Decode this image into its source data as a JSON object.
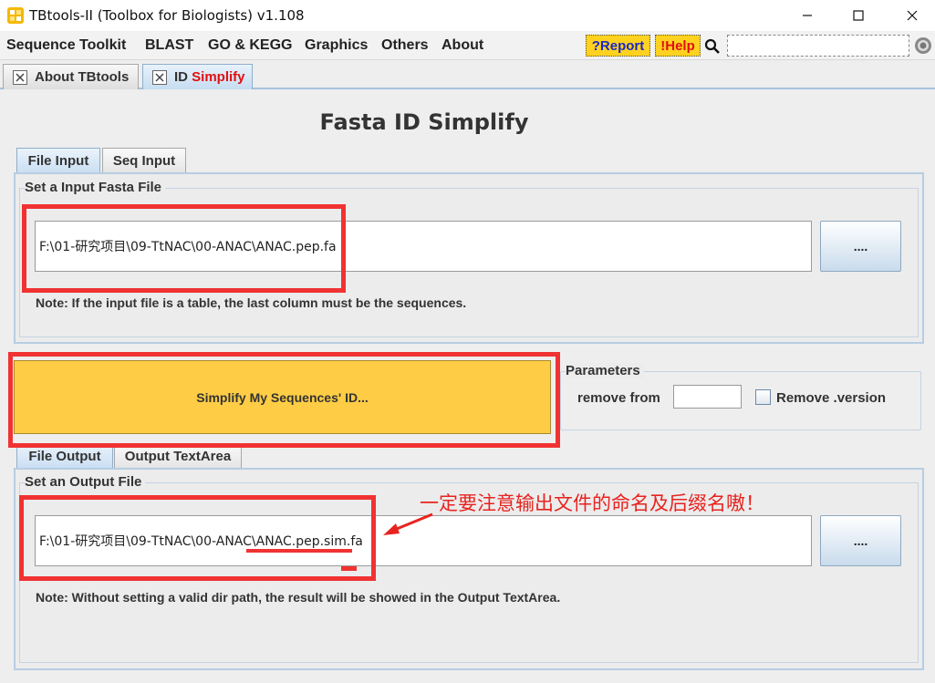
{
  "window": {
    "title": "TBtools-II (Toolbox for Biologists) v1.108",
    "controls": [
      "minimize-icon",
      "maximize-icon",
      "close-icon"
    ]
  },
  "menubar": {
    "items": [
      "Sequence Toolkit",
      "BLAST",
      "GO & KEGG",
      "Graphics",
      "Others",
      "About"
    ],
    "report_label": "?Report",
    "help_label": "!Help",
    "search_value": "",
    "accent_color": "#ffd21f"
  },
  "doc_tabs": {
    "tab1_label": "About TBtools",
    "tab2_prefix": "ID ",
    "tab2_highlight": "Simplify"
  },
  "main": {
    "heading": "Fasta ID Simplify",
    "input_tabs": [
      "File Input",
      "Seq Input"
    ],
    "input_group_title": "Set a Input Fasta File",
    "input_path": "F:\\01-研究项目\\09-TtNAC\\00-ANAC\\ANAC.pep.fa",
    "input_browse": "....",
    "input_note": "Note: If the input file is a table, the last column must be the sequences.",
    "run_button": "Simplify My Sequences' ID...",
    "params_title": "Parameters",
    "remove_from_label": "remove from",
    "remove_from_value": "",
    "remove_version_label": "Remove .version",
    "remove_version_checked": false,
    "output_tabs": [
      "File Output",
      "Output TextArea"
    ],
    "output_group_title": "Set an Output File",
    "output_path": "F:\\01-研究项目\\09-TtNAC\\00-ANAC\\ANAC.pep.sim.fa",
    "output_browse": "....",
    "output_note": "Note: Without setting a valid dir path, the result will be showed in the Output TextArea."
  },
  "annotation": {
    "text": "一定要注意输出文件的命名及后缀名嗷！",
    "color": "#f03232"
  }
}
